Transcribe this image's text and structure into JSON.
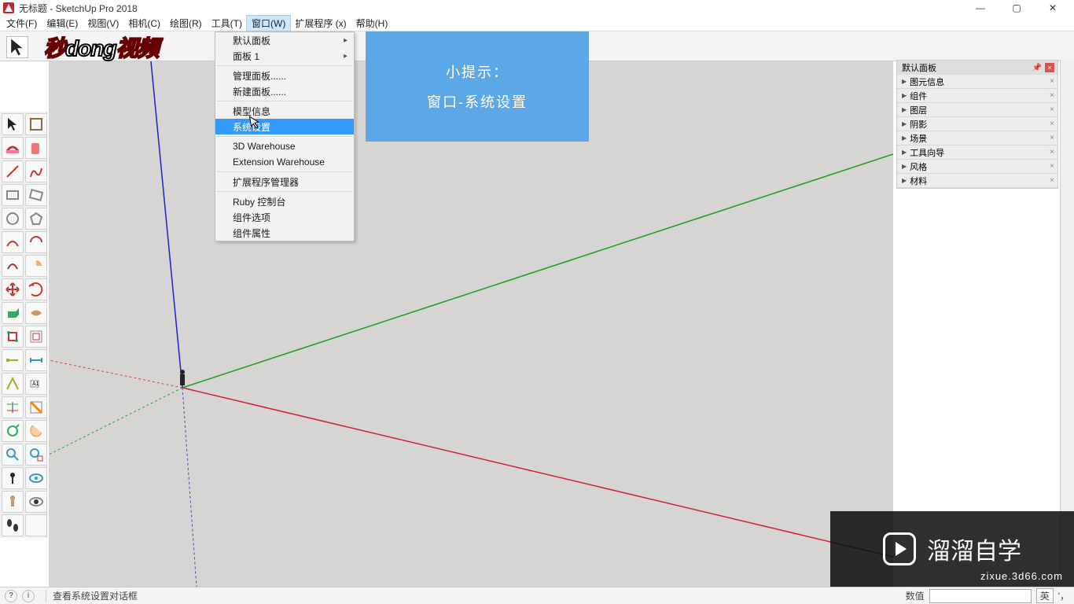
{
  "title": "无标题 - SketchUp Pro 2018",
  "menubar": [
    "文件(F)",
    "编辑(E)",
    "视图(V)",
    "相机(C)",
    "绘图(R)",
    "工具(T)",
    "窗口(W)",
    "扩展程序 (x)",
    "帮助(H)"
  ],
  "active_menu_index": 6,
  "dropdown": {
    "groups": [
      [
        {
          "label": "默认面板",
          "sub": true
        },
        {
          "label": "面板 1",
          "sub": true
        }
      ],
      [
        {
          "label": "管理面板......"
        },
        {
          "label": "新建面板......"
        }
      ],
      [
        {
          "label": "模型信息"
        },
        {
          "label": "系统设置",
          "highlight": true
        }
      ],
      [
        {
          "label": "3D Warehouse"
        },
        {
          "label": "Extension Warehouse"
        }
      ],
      [
        {
          "label": "扩展程序管理器"
        }
      ],
      [
        {
          "label": "Ruby 控制台"
        },
        {
          "label": "组件选项"
        },
        {
          "label": "组件属性"
        }
      ]
    ]
  },
  "tip": {
    "line1": "小提示：",
    "line2": "窗口-系统设置"
  },
  "right_panel": {
    "title": "默认面板",
    "items": [
      "图元信息",
      "组件",
      "图层",
      "阴影",
      "场景",
      "工具向导",
      "风格",
      "材料"
    ]
  },
  "status": {
    "text": "查看系统设置对话框",
    "measure_label": "数值",
    "ime": "英",
    "ime2": "'，"
  },
  "watermark_left_a": "秒",
  "watermark_left_b": "dong",
  "watermark_left_c": "视频",
  "watermark_br_text": "溜溜自学",
  "watermark_br_sub": "zixue.3d66.com",
  "tool_names": [
    "select-tool",
    "lasso-tool",
    "eraser-tool",
    "paint-bucket-tool",
    "line-tool",
    "freehand-tool",
    "rectangle-tool",
    "rotated-rect-tool",
    "circle-tool",
    "polygon-tool",
    "arc-tool",
    "2pt-arc-tool",
    "3pt-arc-tool",
    "pie-tool",
    "move-tool",
    "rotate-tool",
    "pushpull-tool",
    "followme-tool",
    "scale-tool",
    "offset-tool",
    "tape-tool",
    "dimension-tool",
    "protractor-tool",
    "text-tool",
    "axes-tool",
    "section-tool",
    "orbit-tool",
    "pan-tool",
    "zoom-tool",
    "zoom-extents-tool",
    "position-camera-tool",
    "look-around-tool",
    "walk-tool",
    "eye-tool",
    "person-tool",
    "footprints-tool"
  ]
}
